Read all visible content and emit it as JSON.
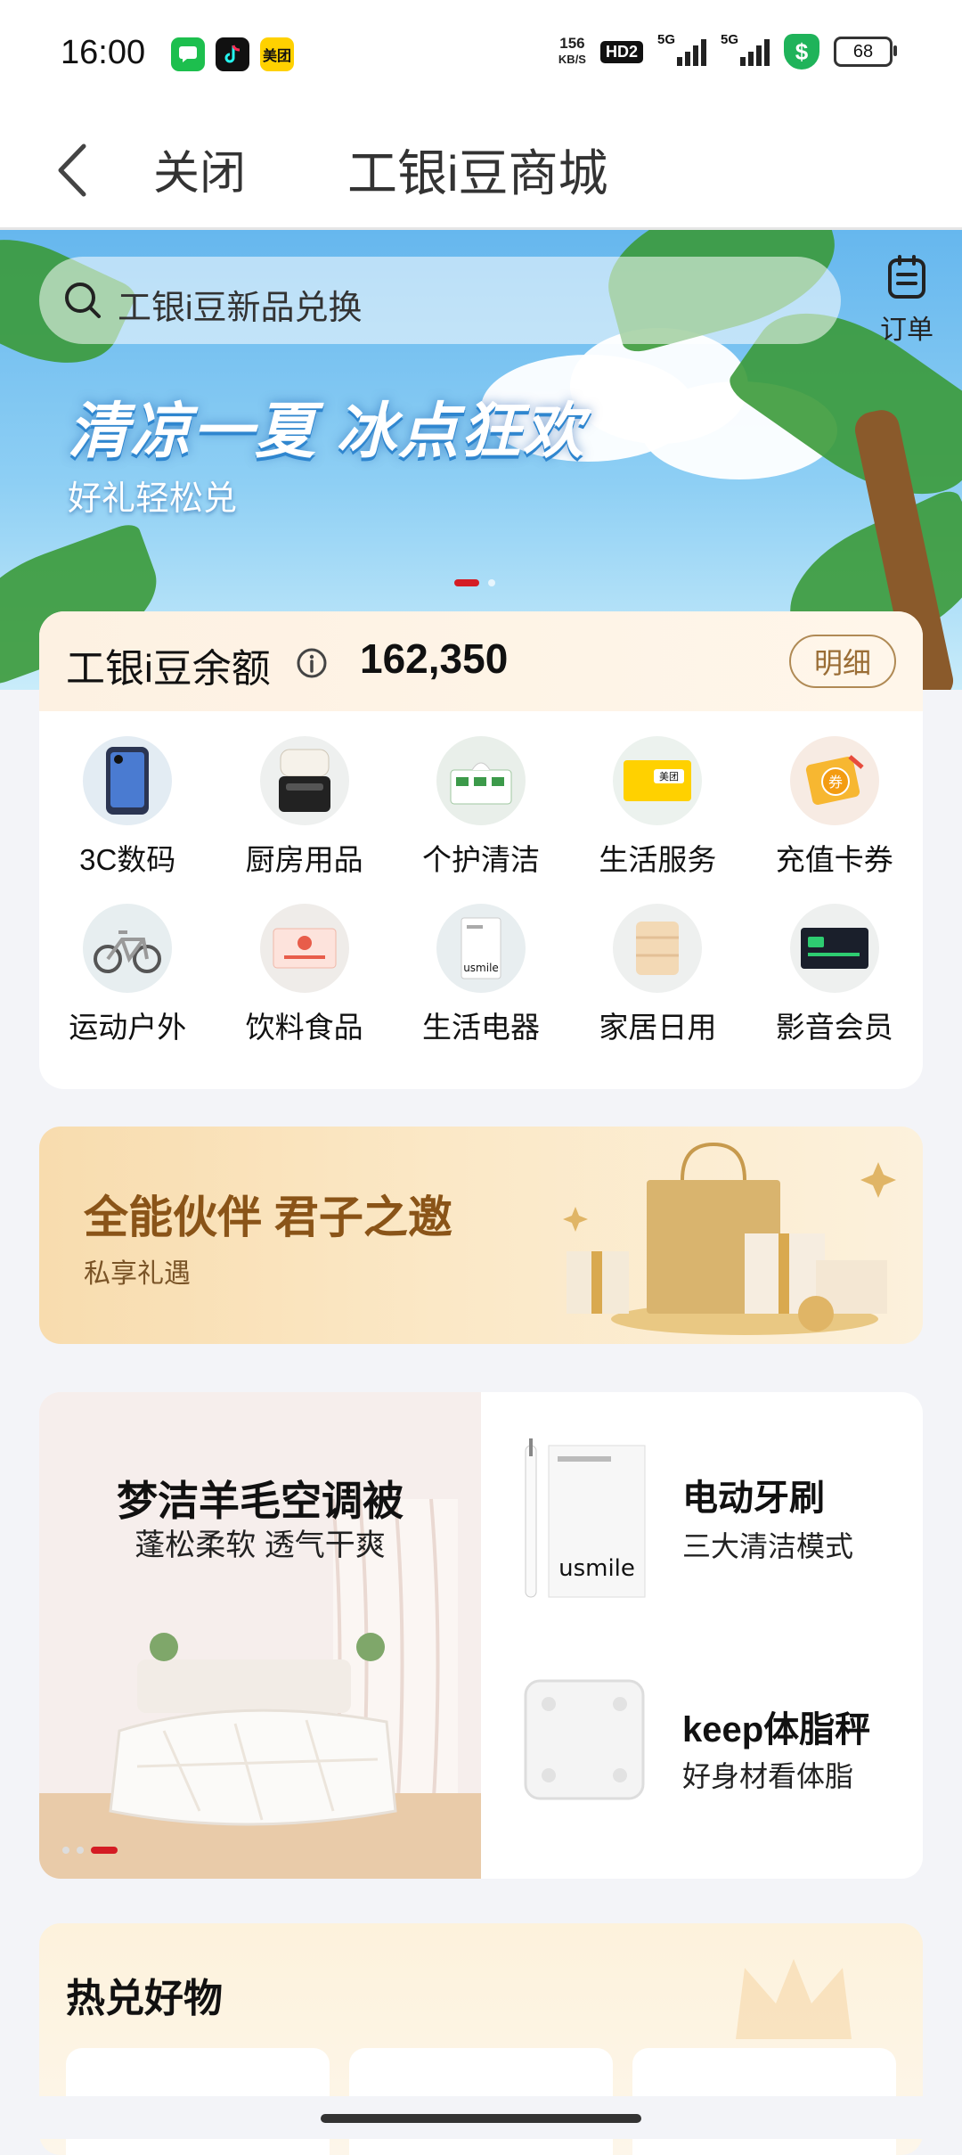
{
  "status_bar": {
    "time": "16:00",
    "net_speed_value": "156",
    "net_speed_unit": "KB/S",
    "hd_badge": "HD2",
    "signal_1": "5G",
    "signal_2": "5G",
    "battery": "68",
    "app_meituan": "美团"
  },
  "header": {
    "close_label": "关闭",
    "title": "工银i豆商城"
  },
  "banner": {
    "search_placeholder": "工银i豆新品兑换",
    "orders_label": "订单",
    "title": "清凉一夏 冰点狂欢",
    "subtitle": "好礼轻松兑"
  },
  "balance": {
    "label": "工银i豆余额",
    "value": "162,350",
    "detail_button": "明细"
  },
  "categories": [
    {
      "label": "3C数码",
      "icon": "phone-icon"
    },
    {
      "label": "厨房用品",
      "icon": "air-fryer-icon"
    },
    {
      "label": "个护清洁",
      "icon": "tissue-icon"
    },
    {
      "label": "生活服务",
      "icon": "meituan-card-icon"
    },
    {
      "label": "充值卡券",
      "icon": "coupon-icon"
    },
    {
      "label": "运动户外",
      "icon": "bicycle-icon"
    },
    {
      "label": "饮料食品",
      "icon": "food-voucher-icon"
    },
    {
      "label": "生活电器",
      "icon": "appliance-icon"
    },
    {
      "label": "家居日用",
      "icon": "towel-icon"
    },
    {
      "label": "影音会员",
      "icon": "membership-card-icon"
    }
  ],
  "promo": {
    "title": "全能伙伴 君子之邀",
    "subtitle": "私享礼遇"
  },
  "products": {
    "feature": {
      "title": "梦洁羊毛空调被",
      "subtitle": "蓬松柔软 透气干爽"
    },
    "items": [
      {
        "title": "电动牙刷",
        "subtitle": "三大清洁模式",
        "brand": "usmile"
      },
      {
        "title": "keep体脂秤",
        "subtitle": "好身材看体脂"
      }
    ]
  },
  "hot": {
    "title": "热兑好物"
  },
  "colors": {
    "accent_red": "#d41c24",
    "gold_text": "#8a5418",
    "detail_border": "#b08a55"
  }
}
